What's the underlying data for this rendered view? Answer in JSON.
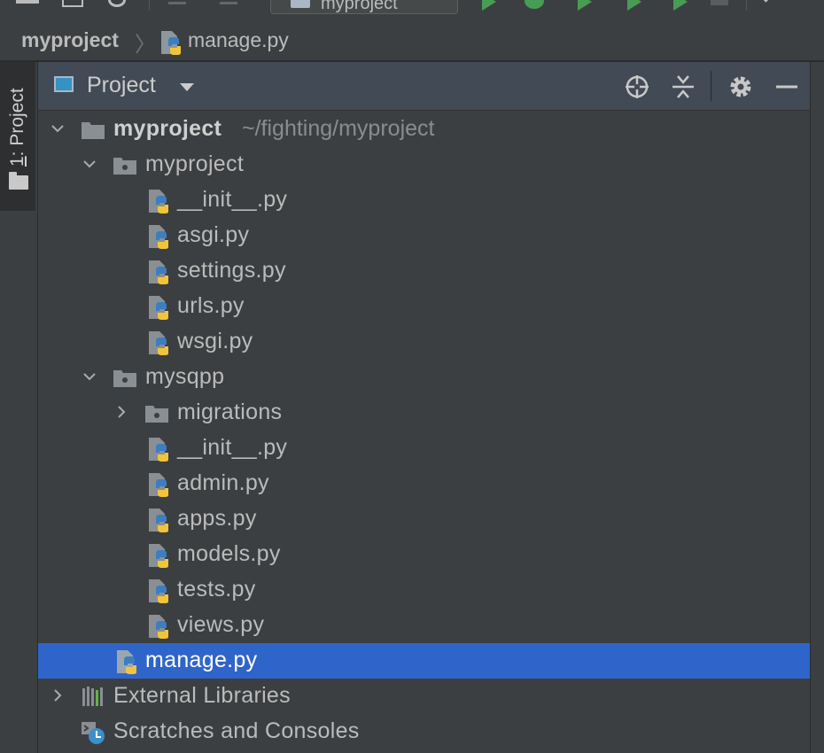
{
  "toolbar": {
    "run_config_label": "myproject"
  },
  "breadcrumb": {
    "project": "myproject",
    "separator": "〉",
    "file": "manage.py"
  },
  "stripe": {
    "tab_number": "1",
    "tab_rest": ": Project"
  },
  "panel": {
    "view_label": "Project",
    "buttons": [
      "locate-icon",
      "collapse-all-icon",
      "gear-icon",
      "hide-icon"
    ]
  },
  "tree": {
    "root": {
      "label": "myproject",
      "path": "~/fighting/myproject"
    },
    "pkg1": {
      "label": "myproject"
    },
    "pkg1_files": [
      "__init__.py",
      "asgi.py",
      "settings.py",
      "urls.py",
      "wsgi.py"
    ],
    "pkg2": {
      "label": "mysqpp"
    },
    "migrations": {
      "label": "migrations"
    },
    "pkg2_files": [
      "__init__.py",
      "admin.py",
      "apps.py",
      "models.py",
      "tests.py",
      "views.py"
    ],
    "manage": {
      "label": "manage.py"
    },
    "external": {
      "label": "External Libraries"
    },
    "scratches": {
      "label": "Scratches and Consoles"
    }
  },
  "colors": {
    "background": "#3c3f41",
    "header": "#414a55",
    "selection": "#2f65ca",
    "text": "#bbbbbb"
  }
}
